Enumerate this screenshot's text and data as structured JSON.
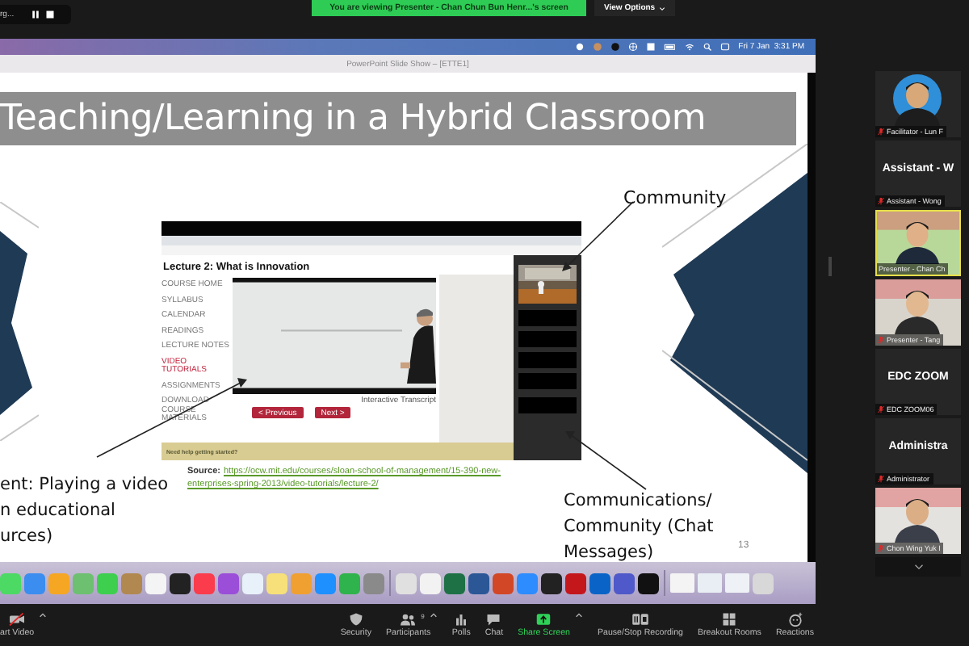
{
  "recording_pill": {
    "text": "rg..."
  },
  "banner": {
    "text": "You are viewing Presenter - Chan Chun Bun Henr...'s screen"
  },
  "view_options": {
    "label": "View Options"
  },
  "shared_screen": {
    "menubar": {
      "clock": "Fri 7 Jan  3:31 PM"
    },
    "window_title": "PowerPoint Slide Show – [ETTE1]",
    "slide": {
      "title": "Teaching/Learning in a Hybrid Classroom",
      "community_label": "Community",
      "left_caption": "ent: Playing a video\nn educational\nurces)",
      "source_label": "Source:",
      "source_link_lines": [
        "https://ocw.mit.edu/courses/sloan-school-of-management/15-390-new-",
        "enterprises-spring-2013/video-tutorials/lecture-2/"
      ],
      "comms_label": "Communications/\nCommunity (Chat\nMessages)",
      "page_number": "13",
      "embedded_page": {
        "heading": "Lecture 2: What is Innovation",
        "nav": [
          {
            "label": "COURSE HOME",
            "selected": false
          },
          {
            "label": "SYLLABUS",
            "selected": false
          },
          {
            "label": "CALENDAR",
            "selected": false
          },
          {
            "label": "READINGS",
            "selected": false
          },
          {
            "label": "LECTURE NOTES",
            "selected": false
          },
          {
            "label": "VIDEO TUTORIALS",
            "selected": true
          },
          {
            "label": "ASSIGNMENTS",
            "selected": false
          },
          {
            "label": "DOWNLOAD COURSE MATERIALS",
            "selected": false
          }
        ],
        "transcript": "Interactive Transcript",
        "buttons": [
          "< Previous",
          "Next >"
        ],
        "help_bar": "Need help getting started?"
      }
    },
    "dock": [
      {
        "kind": "app",
        "color": "#4cd964"
      },
      {
        "kind": "app",
        "color": "#3b8df0"
      },
      {
        "kind": "app",
        "color": "#f5a623"
      },
      {
        "kind": "app",
        "color": "#6cc070"
      },
      {
        "kind": "app",
        "color": "#3ecf4f"
      },
      {
        "kind": "app",
        "color": "#b08850"
      },
      {
        "kind": "app",
        "color": "#f4f4f4"
      },
      {
        "kind": "app",
        "color": "#222222"
      },
      {
        "kind": "app",
        "color": "#fa3c4c"
      },
      {
        "kind": "app",
        "color": "#9b4fd8"
      },
      {
        "kind": "app",
        "color": "#e8f0fa"
      },
      {
        "kind": "app",
        "color": "#f7e07a"
      },
      {
        "kind": "app",
        "color": "#f0a030"
      },
      {
        "kind": "app",
        "color": "#1e90ff"
      },
      {
        "kind": "app",
        "color": "#2fb34c"
      },
      {
        "kind": "app",
        "color": "#8a8a8a"
      },
      {
        "kind": "divider"
      },
      {
        "kind": "app",
        "color": "#e0e0e0"
      },
      {
        "kind": "app",
        "color": "#f2f2f2"
      },
      {
        "kind": "app",
        "color": "#1e7145"
      },
      {
        "kind": "app",
        "color": "#2b5797"
      },
      {
        "kind": "app",
        "color": "#d24726"
      },
      {
        "kind": "app",
        "color": "#2d8cff"
      },
      {
        "kind": "app",
        "color": "#222222"
      },
      {
        "kind": "app",
        "color": "#c4171c"
      },
      {
        "kind": "app",
        "color": "#0a64c8"
      },
      {
        "kind": "app",
        "color": "#5059c9"
      },
      {
        "kind": "app",
        "color": "#111111"
      },
      {
        "kind": "divider"
      },
      {
        "kind": "file",
        "color": "#f4f4f4"
      },
      {
        "kind": "file",
        "color": "#e8eef4"
      },
      {
        "kind": "file",
        "color": "#eef2f6"
      },
      {
        "kind": "app",
        "color": "#d8d8d8"
      }
    ]
  },
  "participants": [
    {
      "kind": "video",
      "label": "Facilitator - Lun F",
      "muted": true,
      "active": false
    },
    {
      "kind": "name",
      "big_name": "Assistant - W",
      "label": "Assistant - Wong",
      "muted": true,
      "active": false
    },
    {
      "kind": "video",
      "label": "Presenter - Chan Ch",
      "muted": false,
      "active": true
    },
    {
      "kind": "video",
      "label": "Presenter - Tang",
      "muted": true,
      "active": false
    },
    {
      "kind": "name",
      "big_name": "EDC ZOOM",
      "label": "EDC ZOOM06",
      "muted": true,
      "active": false
    },
    {
      "kind": "name",
      "big_name": "Administra",
      "label": "Administrator",
      "muted": true,
      "active": false
    },
    {
      "kind": "video",
      "label": "Chon Wing Yuk I",
      "muted": true,
      "active": false
    }
  ],
  "toolbar": [
    {
      "kind": "video",
      "label": "art Video",
      "caret": true
    },
    {
      "kind": "security",
      "label": "Security",
      "caret": false
    },
    {
      "kind": "participants",
      "label": "Participants",
      "count": "9",
      "caret": true
    },
    {
      "kind": "polls",
      "label": "Polls",
      "caret": false
    },
    {
      "kind": "chat",
      "label": "Chat",
      "caret": false
    },
    {
      "kind": "share",
      "label": "Share Screen",
      "caret": true
    },
    {
      "kind": "record",
      "label": "Pause/Stop Recording",
      "caret": false
    },
    {
      "kind": "breakout",
      "label": "Breakout Rooms",
      "caret": false
    },
    {
      "kind": "reactions",
      "label": "Reactions",
      "caret": false
    }
  ]
}
